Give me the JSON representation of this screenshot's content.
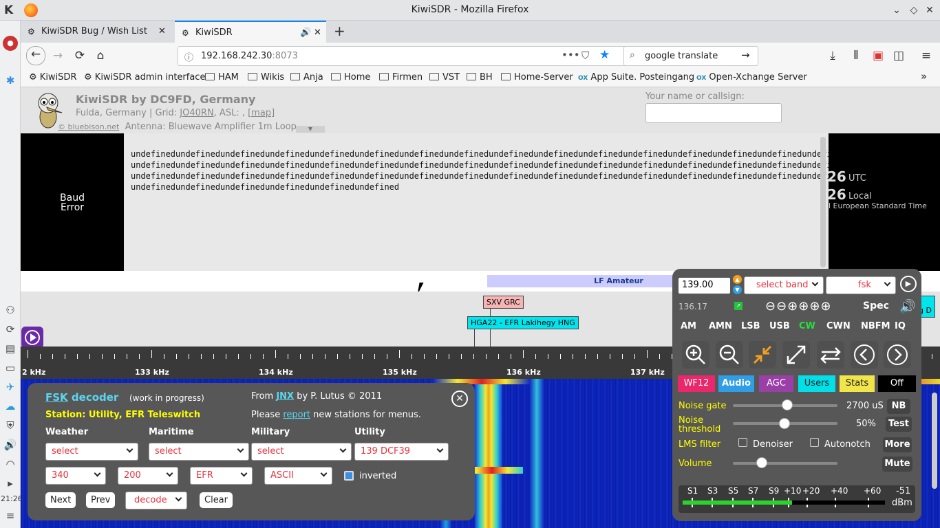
{
  "window": {
    "title": "KiwiSDR - Mozilla Firefox"
  },
  "tabs": [
    {
      "label": "KiwiSDR Bug / Wish List"
    },
    {
      "label": "KiwiSDR"
    }
  ],
  "urlbar": {
    "host": "192.168.242.30",
    "port": ":8073"
  },
  "search": {
    "value": "google translate"
  },
  "bookmarks": [
    "KiwiSDR",
    "KiwiSDR admin interface",
    "HAM",
    "Wikis",
    "Anja",
    "Home",
    "Firmen",
    "VST",
    "BH",
    "Home-Server",
    "App Suite. Posteingang",
    "Open-Xchange Server"
  ],
  "clock": {
    "time": "21:26"
  },
  "header": {
    "title": "KiwiSDR by DC9FD, Germany",
    "location": "Fulda, Germany | Grid: ",
    "grid": "JO40RN",
    "asl": ", ASL: , ",
    "map": "[map]",
    "credit": "© bluebison.net",
    "antenna": "Antenna: Bluewave Amplifier 1m Loop",
    "name_label": "Your name or callsign:"
  },
  "baud_error": [
    "Baud",
    "Error"
  ],
  "console_lines": [
    "undefinedundefinedundefinedundefinedundefinedundefinedundefinedundefinedundefinedundefinedundefinedundefinedundefinedundefinedundefinedundefined",
    "undefinedundefinedundefinedundefinedundefinedundefinedundefinedundefinedundefinedundefinedundefinedundefinedundefinedundefinedundefinedundefined",
    "undefinedundefinedundefinedundefinedundefinedundefinedundefinedundefinedundefinedundefinedundefinedundefinedundefinedundefinedundefinedundefined",
    "undefinedundefinedundefinedundefinedundefinedundefined"
  ],
  "utc_clock": {
    "utc_val": "26",
    "utc_label": "UTC",
    "local_val": "26",
    "local_label": "Local",
    "tz": "l European Standard Time"
  },
  "band": {
    "name": "LF Amateur"
  },
  "station_labels": [
    {
      "text": "SXV GRC",
      "bg": "#f6b4b4"
    },
    {
      "text": "HGA22 - EFR Lakihegy HNG",
      "bg": "#00e5ee"
    },
    {
      "text": "g D",
      "bg": "#00e5ee"
    }
  ],
  "freq_scale": [
    "2 kHz",
    "133 kHz",
    "134 kHz",
    "135 kHz",
    "136 kHz",
    "137 kHz"
  ],
  "fsk": {
    "title_a": "FSK",
    "title_b": " decoder",
    "wip": "(work in progress)",
    "station": "Station: Utility, EFR Teleswitch",
    "from": "From ",
    "jnx": "JNX",
    "by": " by P. Lutus © 2011",
    "please": "Please ",
    "report": "report",
    "new_stations": " new stations for menus.",
    "cat_weather": "Weather",
    "cat_maritime": "Maritime",
    "cat_military": "Military",
    "cat_utility": "Utility",
    "sel_weather": "select",
    "sel_maritime": "select",
    "sel_military": "select",
    "sel_utility": "139 DCF39",
    "shift": "340",
    "baud": "200",
    "framing": "EFR",
    "encoding": "ASCII",
    "inverted": "inverted",
    "next": "Next",
    "prev": "Prev",
    "decode": "decode",
    "clear": "Clear"
  },
  "control": {
    "freq": "139.00",
    "select_band": "select band",
    "mode_select": "fsk",
    "passband": "136.17",
    "spec": "Spec",
    "modes": [
      "AM",
      "AMN",
      "LSB",
      "USB",
      "CW",
      "CWN",
      "NBFM",
      "IQ"
    ],
    "tabs": [
      {
        "label": "WF12",
        "bg": "#e9276a"
      },
      {
        "label": "Audio",
        "bg": "#2f9ee6"
      },
      {
        "label": "AGC",
        "bg": "#9b3fa8"
      },
      {
        "label": "Users",
        "bg": "#00e0e8"
      },
      {
        "label": "Stats",
        "bg": "#f1e54a"
      },
      {
        "label": "Off",
        "bg": "#000000"
      }
    ],
    "noise_gate": "Noise gate",
    "noise_gate_val": "2700 uS",
    "nb": "NB",
    "noise_threshold_a": "Noise",
    "noise_threshold_b": "threshold",
    "noise_threshold_val": "50%",
    "test": "Test",
    "lms": "LMS filter",
    "denoiser": "Denoiser",
    "autonotch": "Autonotch",
    "more": "More",
    "volume": "Volume",
    "mute": "Mute",
    "smeter_labels": [
      "S1",
      "S3",
      "S5",
      "S7",
      "S9",
      "+10",
      "+20",
      "+40",
      "+60"
    ],
    "smeter_val": "-51",
    "smeter_unit": "dBm",
    "smeter_level": 0.54
  }
}
